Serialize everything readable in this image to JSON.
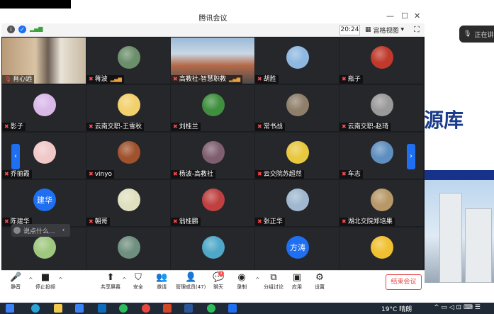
{
  "window": {
    "title": "腾讯会议",
    "time": "20:24",
    "view_label": "宫格视图"
  },
  "participants": [
    {
      "name": "肖心远",
      "kind": "video",
      "host": true
    },
    {
      "name": "蒋波",
      "kind": "photo",
      "color": "#6b8e6b",
      "signal": true
    },
    {
      "name": "高教社-智慧职教",
      "kind": "video2",
      "signal": true
    },
    {
      "name": "胡胜",
      "kind": "photo",
      "color": "#8fb8e0"
    },
    {
      "name": "瓶子",
      "kind": "photo",
      "color": "#c0392b"
    },
    {
      "name": "影子",
      "kind": "photo",
      "color": "#d9b8e8"
    },
    {
      "name": "云南交职-王雪秋",
      "kind": "photo",
      "color": "#f2d06b"
    },
    {
      "name": "刘桂兰",
      "kind": "photo",
      "color": "#3f8f3f"
    },
    {
      "name": "常书战",
      "kind": "photo",
      "color": "#8f7f6a"
    },
    {
      "name": "云南交职-赵琦",
      "kind": "photo",
      "color": "#9a9a9a"
    },
    {
      "name": "乔丽霞",
      "kind": "photo",
      "color": "#f0c8c8"
    },
    {
      "name": "vinyo",
      "kind": "photo",
      "color": "#a0522d"
    },
    {
      "name": "杨波-高教社",
      "kind": "photo",
      "color": "#7f5f6f"
    },
    {
      "name": "云交院苏超然",
      "kind": "photo",
      "color": "#e8c840"
    },
    {
      "name": "车志",
      "kind": "photo",
      "color": "#5f8fbf"
    },
    {
      "name": "陈建华",
      "kind": "text",
      "avatar_text": "建华"
    },
    {
      "name": "朝哥",
      "kind": "photo",
      "color": "#e0e0c0"
    },
    {
      "name": "翁桂鹏",
      "kind": "photo",
      "color": "#c04040"
    },
    {
      "name": "张正华",
      "kind": "photo",
      "color": "#9fb8cf"
    },
    {
      "name": "湖北交院郑培果",
      "kind": "photo",
      "color": "#b89868"
    },
    {
      "name": "",
      "kind": "photo",
      "color": "#9fc87f"
    },
    {
      "name": "",
      "kind": "photo",
      "color": "#6f8f7f"
    },
    {
      "name": "",
      "kind": "photo",
      "color": "#4fa8c8"
    },
    {
      "name": "",
      "kind": "text",
      "avatar_text": "方涛"
    },
    {
      "name": "",
      "kind": "photo",
      "color": "#f0c030"
    }
  ],
  "chat": {
    "placeholder": "说点什么..."
  },
  "toolbar": {
    "mute": "静音",
    "stop_video": "停止投频",
    "share": "共享屏幕",
    "security": "安全",
    "invite": "邀请",
    "manage": "管理成员(47)",
    "chat": "聊天",
    "chat_badge": "1",
    "record": "录制",
    "breakout": "分组讨论",
    "apps": "应用",
    "settings": "设置",
    "end": "结束会议"
  },
  "background": {
    "slide_text": "源库",
    "stream_label": "正在讲"
  },
  "taskbar": {
    "weather": "19°C 晴朗"
  }
}
